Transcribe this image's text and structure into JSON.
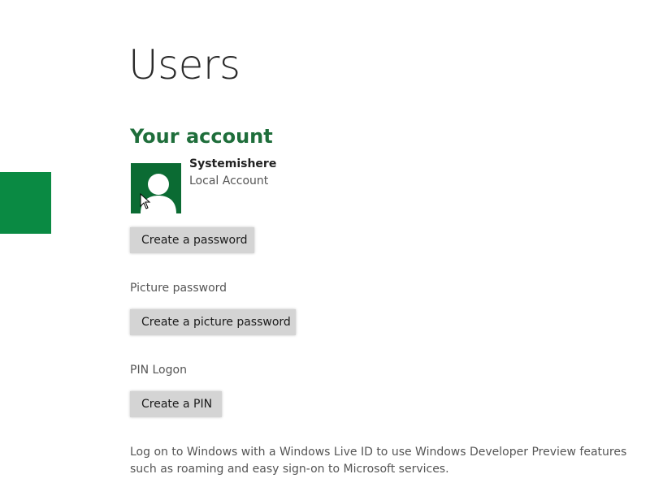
{
  "colors": {
    "accent": "#0a8a43",
    "section_title": "#1f6e3b",
    "avatar_bg": "#0b6b33",
    "button_bg": "#d4d4d4"
  },
  "page": {
    "title": "Users"
  },
  "account": {
    "section_title": "Your account",
    "user_name": "Systemishere",
    "user_type": "Local Account",
    "avatar_icon": "user-silhouette-icon"
  },
  "password": {
    "create_label": "Create a password"
  },
  "picture_password": {
    "label": "Picture password",
    "create_label": "Create a picture password"
  },
  "pin": {
    "label": "PIN Logon",
    "create_label": "Create a PIN"
  },
  "info": {
    "text": "Log on to Windows with a Windows Live ID to use Windows Developer Preview features such as roaming and easy sign-on to Microsoft services."
  }
}
